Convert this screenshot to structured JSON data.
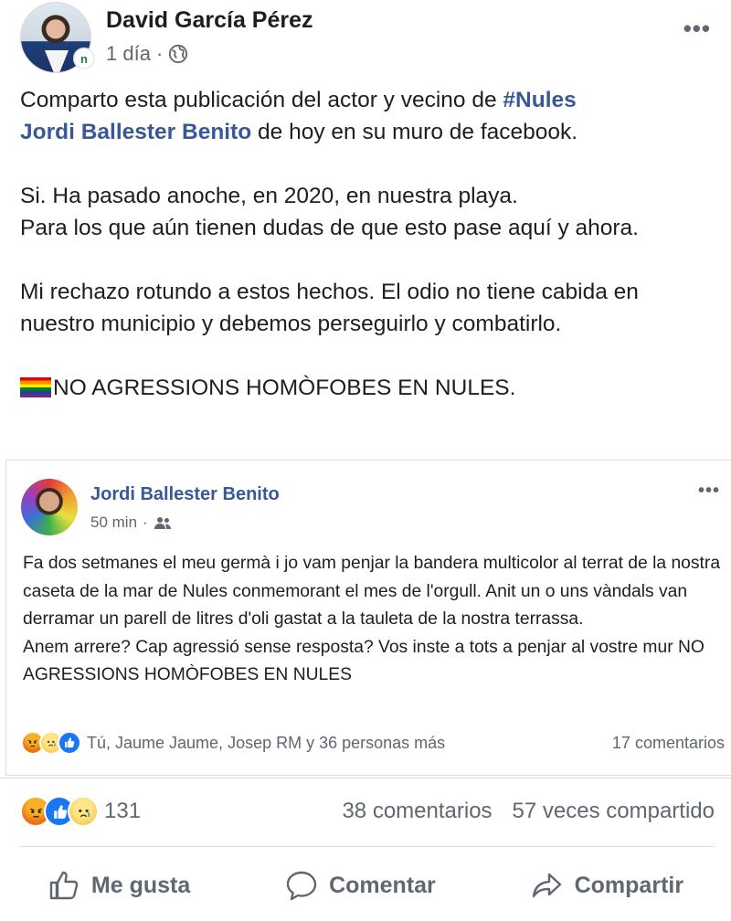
{
  "post": {
    "author": "David García Pérez",
    "timestamp": "1 día",
    "meta_separator": "·",
    "privacy_icon": "globe-icon",
    "badge_letter": "n",
    "more_icon": "•••",
    "intro_before": "Comparto esta publicación del actor y vecino de ",
    "hashtag": "#Nules",
    "intro_link": "Jordi Ballester Benito",
    "intro_after": " de hoy en su muro de facebook.",
    "p2_l1": "Si. Ha pasado anoche, en 2020, en nuestra playa.",
    "p2_l2": "Para los que aún tienen dudas de que esto pase aquí y ahora.",
    "p3": "Mi rechazo rotundo a estos hechos. El odio no tiene cabida en nuestro municipio y debemos perseguirlo y combatirlo.",
    "p4": "NO AGRESSIONS HOMÒFOBES EN NULES."
  },
  "shared": {
    "author": "Jordi Ballester Benito",
    "timestamp": "50 min",
    "meta_separator": "·",
    "privacy_icon": "friends-icon",
    "more_icon": "•••",
    "text_l1": "Fa dos setmanes el meu germà i jo vam penjar la bandera multicolor al terrat de la nostra caseta de la mar de Nules conmemorant el mes de l'orgull. Anit un o uns vàndals van derramar un parell de litres d'oli gastat a la tauleta de la nostra terrassa.",
    "text_l2": "Anem arrere? Cap agressió sense resposta? Vos inste a tots a penjar al vostre mur NO AGRESSIONS HOMÒFOBES EN NULES",
    "reactors": "Tú, Jaume Jaume, Josep RM y 36 personas más",
    "comments": "17 comentarios"
  },
  "stats": {
    "reaction_count": "131",
    "comments": "38 comentarios",
    "shares": "57 veces compartido"
  },
  "actions": {
    "like": "Me gusta",
    "comment": "Comentar",
    "share": "Compartir"
  },
  "colors": {
    "link": "#385898",
    "meta": "#606770",
    "text": "#1c1e21",
    "like_blue": "#1877f2"
  }
}
